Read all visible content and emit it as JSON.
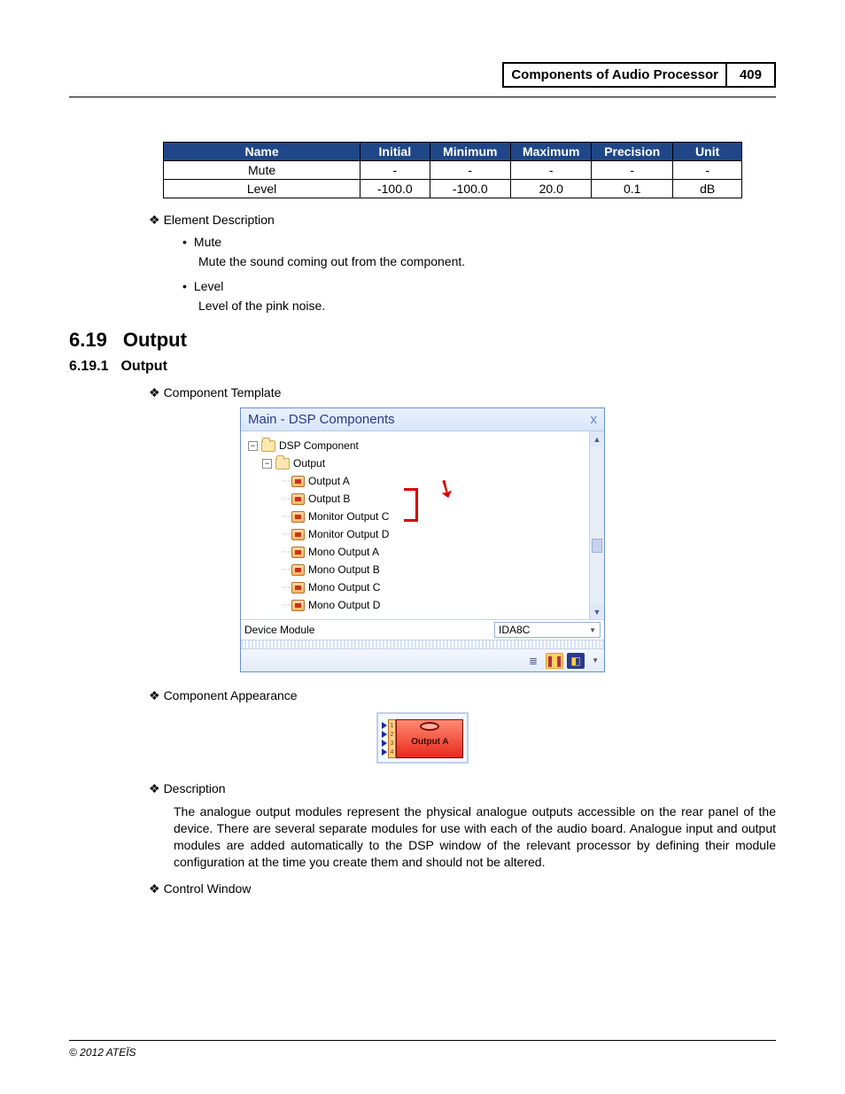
{
  "header": {
    "title": "Components of Audio Processor",
    "page": "409"
  },
  "table": {
    "headers": [
      "Name",
      "Initial",
      "Minimum",
      "Maximum",
      "Precision",
      "Unit"
    ],
    "rows": [
      {
        "name": "Mute",
        "initial": "-",
        "minimum": "-",
        "maximum": "-",
        "precision": "-",
        "unit": "-"
      },
      {
        "name": "Level",
        "initial": "-100.0",
        "minimum": "-100.0",
        "maximum": "20.0",
        "precision": "0.1",
        "unit": "dB"
      }
    ]
  },
  "elem_desc": {
    "heading": "Element Description",
    "items": [
      {
        "name": "Mute",
        "desc": "Mute the sound coming out from the component."
      },
      {
        "name": "Level",
        "desc": "Level of the pink noise."
      }
    ]
  },
  "sec": {
    "num": "6.19",
    "title": "Output"
  },
  "subsec": {
    "num": "6.19.1",
    "title": "Output"
  },
  "labels": {
    "component_template": "Component Template",
    "component_appearance": "Component Appearance",
    "description": "Description",
    "control_window": "Control Window"
  },
  "window": {
    "title": "Main - DSP Components",
    "root": "DSP Component",
    "group": "Output",
    "leaves": [
      "Output A",
      "Output B",
      "Monitor Output C",
      "Monitor Output D",
      "Mono Output A",
      "Mono Output B",
      "Mono Output C",
      "Mono Output D"
    ],
    "device_module_label": "Device Module",
    "device_module_value": "IDA8C"
  },
  "component": {
    "label": "Output A",
    "ports": [
      "1",
      "2",
      "3",
      "4"
    ]
  },
  "description_text": "The analogue output modules represent the physical analogue outputs accessible on the rear panel of the device. There are several separate modules for use with each of the audio board. Analogue input and output modules are added automatically to the DSP window of the relevant processor by defining their module configuration at the time you create them and should not be altered.",
  "footer": "© 2012 ATEÏS"
}
